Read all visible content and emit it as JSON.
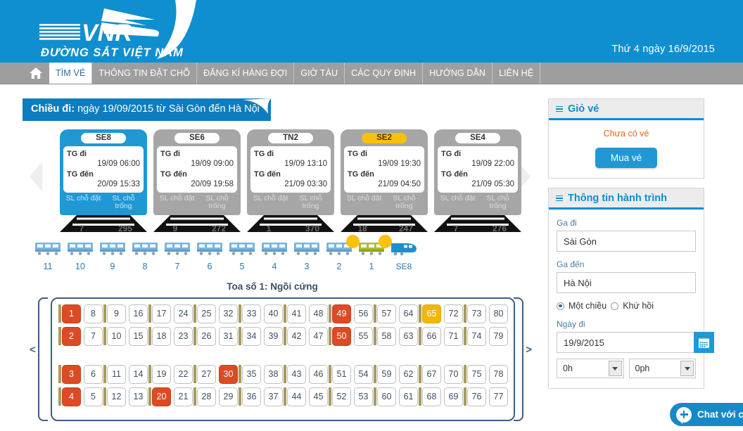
{
  "header": {
    "logo_title": "VNR",
    "logo_subtitle": "ĐƯỜNG SẮT VIỆT NAM",
    "date_text": "Thứ 4 ngày 16/9/2015"
  },
  "nav": {
    "home_icon": "home-icon",
    "items": [
      {
        "label": "TÌM VÉ",
        "active": true
      },
      {
        "label": "THÔNG TIN ĐẶT CHỖ",
        "active": false
      },
      {
        "label": "ĐĂNG KÍ HÀNG ĐỢI",
        "active": false
      },
      {
        "label": "GIỜ TÀU",
        "active": false
      },
      {
        "label": "CÁC QUY ĐỊNH",
        "active": false
      },
      {
        "label": "HƯỚNG DẪN",
        "active": false
      },
      {
        "label": "LIÊN HỆ",
        "active": false
      }
    ]
  },
  "direction": {
    "prefix": "Chiều đi:",
    "detail": "ngày 19/09/2015 từ Sài Gòn đến Hà Nội"
  },
  "trains": {
    "prev_arrow": "chevron-left-icon",
    "next_arrow": "chevron-right-icon",
    "depart_label": "TG đi",
    "arrive_label": "TG đến",
    "seats_booked_label": "SL chỗ đặt",
    "seats_free_label": "SL chỗ trống",
    "items": [
      {
        "code": "SE8",
        "depart": "19/09 06:00",
        "arrive": "20/09 15:33",
        "booked": "7",
        "free": "295",
        "state": "selected"
      },
      {
        "code": "SE6",
        "depart": "19/09 09:00",
        "arrive": "20/09 19:58",
        "booked": "9",
        "free": "272",
        "state": "normal"
      },
      {
        "code": "TN2",
        "depart": "19/09 13:10",
        "arrive": "21/09 03:30",
        "booked": "1",
        "free": "370",
        "state": "normal"
      },
      {
        "code": "SE2",
        "depart": "19/09 19:30",
        "arrive": "21/09 04:50",
        "booked": "18",
        "free": "247",
        "state": "gold"
      },
      {
        "code": "SE4",
        "depart": "19/09 22:00",
        "arrive": "21/09 05:30",
        "booked": "7",
        "free": "276",
        "state": "normal"
      }
    ]
  },
  "carriages": {
    "items": [
      {
        "label": "11",
        "type": "car",
        "selected": false
      },
      {
        "label": "10",
        "type": "car",
        "selected": false
      },
      {
        "label": "9",
        "type": "car",
        "selected": false
      },
      {
        "label": "8",
        "type": "car",
        "selected": false
      },
      {
        "label": "7",
        "type": "car",
        "selected": false
      },
      {
        "label": "6",
        "type": "car",
        "selected": false
      },
      {
        "label": "5",
        "type": "car",
        "selected": false
      },
      {
        "label": "4",
        "type": "car",
        "selected": false
      },
      {
        "label": "3",
        "type": "car",
        "selected": false
      },
      {
        "label": "2",
        "type": "car",
        "selected": false
      },
      {
        "label": "1",
        "type": "car",
        "selected": true
      },
      {
        "label": "SE8",
        "type": "locomotive",
        "selected": false
      }
    ]
  },
  "coach": {
    "title": "Toa số 1: Ngồi cứng",
    "prev_arrow": "chevron-left-icon",
    "next_arrow": "chevron-right-icon",
    "rows": [
      {
        "seats": [
          {
            "n": "1",
            "s": "booked"
          },
          {
            "n": "8",
            "s": "free"
          },
          {
            "n": "9",
            "s": "free"
          },
          {
            "n": "16",
            "s": "free"
          },
          {
            "n": "17",
            "s": "free"
          },
          {
            "n": "24",
            "s": "free"
          },
          {
            "n": "25",
            "s": "free"
          },
          {
            "n": "32",
            "s": "free"
          },
          {
            "n": "33",
            "s": "free"
          },
          {
            "n": "40",
            "s": "free"
          },
          {
            "n": "41",
            "s": "free"
          },
          {
            "n": "48",
            "s": "free"
          },
          {
            "n": "49",
            "s": "booked"
          },
          {
            "n": "56",
            "s": "free"
          },
          {
            "n": "57",
            "s": "free"
          },
          {
            "n": "64",
            "s": "free"
          },
          {
            "n": "65",
            "s": "held"
          },
          {
            "n": "72",
            "s": "free"
          },
          {
            "n": "73",
            "s": "free"
          },
          {
            "n": "80",
            "s": "free"
          }
        ]
      },
      {
        "seats": [
          {
            "n": "2",
            "s": "booked"
          },
          {
            "n": "7",
            "s": "free"
          },
          {
            "n": "10",
            "s": "free"
          },
          {
            "n": "15",
            "s": "free"
          },
          {
            "n": "18",
            "s": "free"
          },
          {
            "n": "23",
            "s": "free"
          },
          {
            "n": "26",
            "s": "free"
          },
          {
            "n": "31",
            "s": "free"
          },
          {
            "n": "34",
            "s": "free"
          },
          {
            "n": "39",
            "s": "free"
          },
          {
            "n": "42",
            "s": "free"
          },
          {
            "n": "47",
            "s": "free"
          },
          {
            "n": "50",
            "s": "booked"
          },
          {
            "n": "55",
            "s": "free"
          },
          {
            "n": "58",
            "s": "free"
          },
          {
            "n": "63",
            "s": "free"
          },
          {
            "n": "66",
            "s": "free"
          },
          {
            "n": "71",
            "s": "free"
          },
          {
            "n": "74",
            "s": "free"
          },
          {
            "n": "79",
            "s": "free"
          }
        ]
      },
      {
        "seats": [
          {
            "n": "3",
            "s": "booked"
          },
          {
            "n": "6",
            "s": "free"
          },
          {
            "n": "11",
            "s": "free"
          },
          {
            "n": "14",
            "s": "free"
          },
          {
            "n": "19",
            "s": "free"
          },
          {
            "n": "22",
            "s": "free"
          },
          {
            "n": "27",
            "s": "free"
          },
          {
            "n": "30",
            "s": "booked"
          },
          {
            "n": "35",
            "s": "free"
          },
          {
            "n": "38",
            "s": "free"
          },
          {
            "n": "43",
            "s": "free"
          },
          {
            "n": "46",
            "s": "free"
          },
          {
            "n": "51",
            "s": "free"
          },
          {
            "n": "54",
            "s": "free"
          },
          {
            "n": "59",
            "s": "free"
          },
          {
            "n": "62",
            "s": "free"
          },
          {
            "n": "67",
            "s": "free"
          },
          {
            "n": "70",
            "s": "free"
          },
          {
            "n": "75",
            "s": "free"
          },
          {
            "n": "78",
            "s": "free"
          }
        ]
      },
      {
        "seats": [
          {
            "n": "4",
            "s": "booked"
          },
          {
            "n": "5",
            "s": "free"
          },
          {
            "n": "12",
            "s": "free"
          },
          {
            "n": "13",
            "s": "free"
          },
          {
            "n": "20",
            "s": "booked"
          },
          {
            "n": "21",
            "s": "free"
          },
          {
            "n": "28",
            "s": "free"
          },
          {
            "n": "29",
            "s": "free"
          },
          {
            "n": "36",
            "s": "free"
          },
          {
            "n": "37",
            "s": "free"
          },
          {
            "n": "44",
            "s": "free"
          },
          {
            "n": "45",
            "s": "free"
          },
          {
            "n": "52",
            "s": "free"
          },
          {
            "n": "53",
            "s": "free"
          },
          {
            "n": "60",
            "s": "free"
          },
          {
            "n": "61",
            "s": "free"
          },
          {
            "n": "68",
            "s": "free"
          },
          {
            "n": "69",
            "s": "free"
          },
          {
            "n": "76",
            "s": "free"
          },
          {
            "n": "77",
            "s": "free"
          }
        ]
      }
    ]
  },
  "cart": {
    "title": "Giỏ vé",
    "empty_text": "Chưa có vé",
    "buy_label": "Mua vé"
  },
  "journey": {
    "title": "Thông tin hành trình",
    "from_label": "Ga đi",
    "from_value": "Sài Gòn",
    "to_label": "Ga đến",
    "to_value": "Hà Nội",
    "oneway_label": "Một chiều",
    "roundtrip_label": "Khứ hồi",
    "trip_type": "oneway",
    "date_label": "Ngày đi",
    "date_value": "19/9/2015",
    "calendar_icon": "calendar-icon",
    "hour_value": "0h",
    "minute_value": "0ph"
  },
  "chat": {
    "label": "Chat với ch",
    "icon": "chat-bubble-icon"
  },
  "colors": {
    "brand_blue": "#108fd0",
    "nav_gray": "#9e9e9e",
    "seat_booked": "#dc4b25",
    "seat_held": "#f2b705",
    "accent_orange": "#e06810"
  }
}
